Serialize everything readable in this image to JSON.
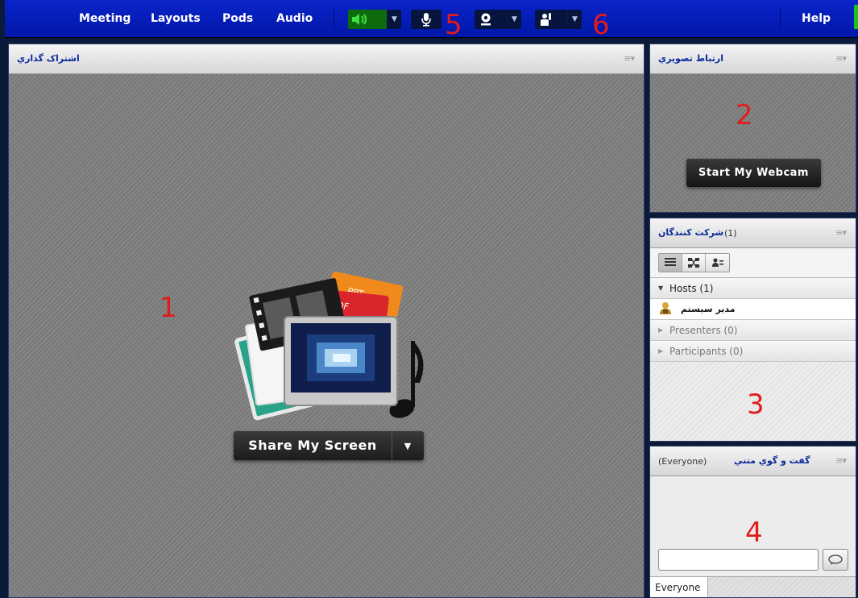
{
  "menubar": {
    "items": [
      {
        "label": "Meeting"
      },
      {
        "label": "Layouts"
      },
      {
        "label": "Pods"
      },
      {
        "label": "Audio"
      }
    ],
    "help": "Help",
    "toolbar": {
      "speaker_icon": "speaker-icon",
      "microphone_icon": "microphone-icon",
      "webcam_icon": "webcam-icon",
      "status_icon": "raise-hand-icon"
    },
    "accent_color": "#0a1fb8",
    "audio_on_color": "#0d6b0d"
  },
  "annotations": [
    "1",
    "2",
    "3",
    "4",
    "5",
    "6"
  ],
  "share_pod": {
    "title": "اشتراک گذاري",
    "button_label": "Share My Screen",
    "art_labels": [
      "PPT",
      "PDF"
    ]
  },
  "webcam_pod": {
    "title": "ارتباط تصويري",
    "button_label": "Start My Webcam"
  },
  "attendees_pod": {
    "title": "شرکت کنندگان",
    "count": "(1)",
    "groups": [
      {
        "label": "Hosts (1)",
        "expanded": true
      },
      {
        "label": "Presenters (0)",
        "expanded": false
      },
      {
        "label": "Participants (0)",
        "expanded": false
      }
    ],
    "host_user": "مدير سيستم"
  },
  "chat_pod": {
    "title": "گفت و گوي متني",
    "audience": "(Everyone)",
    "tab_label": "Everyone",
    "input_value": ""
  }
}
